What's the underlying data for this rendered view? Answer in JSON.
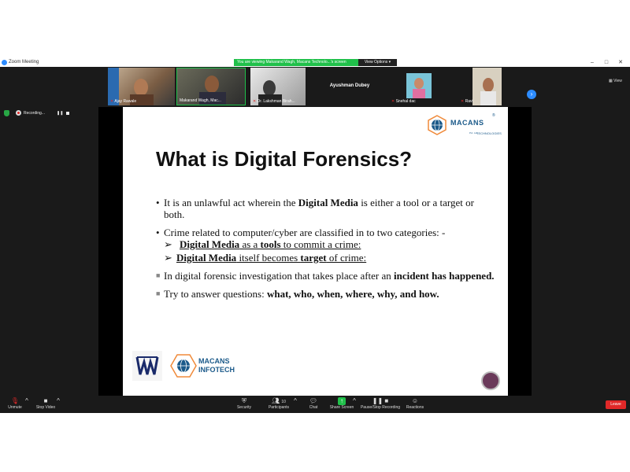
{
  "window": {
    "title": "Zoom Meeting",
    "controls": [
      "–",
      "□",
      "✕"
    ]
  },
  "banner": {
    "text": "You are viewing Makarand Wagh, Macans Technolo...'s screen",
    "view_options": "View Options ▾"
  },
  "participants": [
    {
      "name": "Ajay Rawale",
      "icon": "mic-muted-icon"
    },
    {
      "name": "Makarand Wagh, Mac...",
      "icon": "none"
    },
    {
      "name": "Dr. Lakshman Birah...",
      "icon": "mic-muted-icon"
    },
    {
      "name": "Ayushman Dubey",
      "icon": "none"
    },
    {
      "name": "Snehal dac",
      "icon": "mic-muted-icon"
    },
    {
      "name": "Ravi",
      "icon": "mic-muted-icon"
    }
  ],
  "view_button": "View",
  "recording": {
    "label": "Recording...",
    "pause": "❚❚"
  },
  "slide": {
    "logo_brand": "MACANS",
    "logo_sub": "TECHNOLOGIES",
    "logo_sub2": "Pvt. Ltd.",
    "logo_reg": "®",
    "title": "What is Digital Forensics?",
    "bullet1_a": "It is an unlawful act wherein the ",
    "bullet1_bold": "Digital Media",
    "bullet1_b": " is either a tool or a target or both.",
    "bullet2": "Crime related to computer/cyber are classified in to two categories: -",
    "sub1_bold": "Digital Media",
    "sub1_a": " as a ",
    "sub1_bold2": "tools",
    "sub1_b": " to commit a crime:",
    "sub2_bold": "Digital Media",
    "sub2_a": " itself becomes ",
    "sub2_bold2": "target",
    "sub2_b": " of crime:",
    "bullet3_a": "In digital forensic investigation that takes place after an ",
    "bullet3_bold": "incident has happened.",
    "bullet4_a": "Try to answer questions: ",
    "bullet4_bold": "what, who, when, where, why, and how.",
    "bottom_brand1": "MACANS",
    "bottom_brand2": "INFOTECH"
  },
  "toolbar": {
    "unmute": "Unmute",
    "stop_video": "Stop Video",
    "security": "Security",
    "participants": "Participants",
    "participants_count": "10",
    "chat": "Chat",
    "share_screen": "Share Screen",
    "pause_recording": "Pause/Stop Recording",
    "reactions": "Reactions",
    "leave": "Leave"
  },
  "colors": {
    "zoom_blue": "#2d8cff",
    "banner_green": "#20c04a",
    "leave_red": "#e02828",
    "brand_blue": "#1b5a8a"
  }
}
